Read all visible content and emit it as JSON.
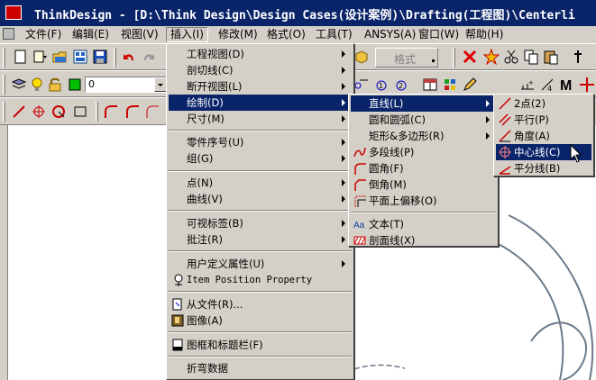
{
  "titlebar": {
    "title": "ThinkDesign  - [D:\\Think Design\\Design Cases(设计案例)\\Drafting(工程图)\\Centerli"
  },
  "menubar": [
    {
      "label": "文件(F)"
    },
    {
      "label": "编辑(E)"
    },
    {
      "label": "视图(V)"
    },
    {
      "label": "插入(I)"
    },
    {
      "label": "修改(M)"
    },
    {
      "label": "格式(O)"
    },
    {
      "label": "工具(T)"
    },
    {
      "label": "ANSYS(A)"
    },
    {
      "label": "窗口(W)"
    },
    {
      "label": "帮助(H)"
    }
  ],
  "toolbar": {
    "layer_value": "0",
    "format_label": "格式"
  },
  "insert_menu": [
    {
      "label": "工程视图(D)"
    },
    {
      "label": "剖切线(C)"
    },
    {
      "label": "断开视图(L)"
    },
    {
      "label": "绘制(D)"
    },
    {
      "label": "尺寸(M)"
    },
    {
      "label": "零件序号(U)"
    },
    {
      "label": "组(G)"
    },
    {
      "label": "点(N)"
    },
    {
      "label": "曲线(V)"
    },
    {
      "label": "可视标签(B)"
    },
    {
      "label": "批注(R)"
    },
    {
      "label": "用户定义属性(U)"
    },
    {
      "label": "Item Position Property"
    },
    {
      "label": "从文件(R)..."
    },
    {
      "label": "图像(A)"
    },
    {
      "label": "图框和标题栏(F)"
    },
    {
      "label": "折弯数据"
    }
  ],
  "draw_menu": [
    {
      "label": "直线(L)"
    },
    {
      "label": "圆和圆弧(C)"
    },
    {
      "label": "矩形&多边形(R)"
    },
    {
      "label": "多段线(P)"
    },
    {
      "label": "圆角(F)"
    },
    {
      "label": "倒角(M)"
    },
    {
      "label": "平面上偏移(O)"
    },
    {
      "label": "文本(T)"
    },
    {
      "label": "剖面线(X)"
    }
  ],
  "line_menu": [
    {
      "label": "2点(2)"
    },
    {
      "label": "平行(P)"
    },
    {
      "label": "角度(A)"
    },
    {
      "label": "中心线(C)"
    },
    {
      "label": "平分线(B)"
    }
  ],
  "colors": {
    "highlight": "#0a246a",
    "face": "#d4d0c8"
  }
}
